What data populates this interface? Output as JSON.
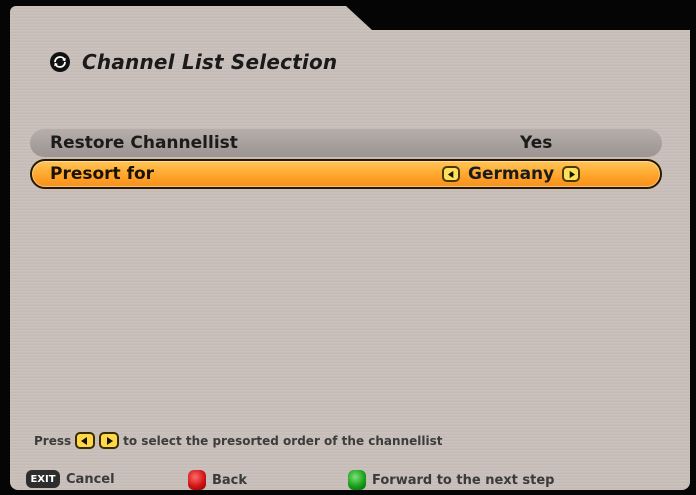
{
  "screen": {
    "title": "Channel List Selection",
    "title_icon": "circle-arrow-icon"
  },
  "rows": [
    {
      "label": "Restore Channellist",
      "value": "Yes",
      "selected": false
    },
    {
      "label": "Presort for",
      "value": "Germany",
      "selected": true
    }
  ],
  "hint": {
    "prefix": "Press",
    "suffix": "to select the presorted order of the channellist",
    "left_icon": "left-arrow-icon",
    "right_icon": "right-arrow-icon"
  },
  "footer": {
    "exit_label": "EXIT",
    "cancel_label": "Cancel",
    "back_label": "Back",
    "forward_label": "Forward to the next step"
  },
  "colors": {
    "panel": "#c8bfba",
    "selected_row": "#ffb13b",
    "red_button": "#d11515",
    "green_button": "#1aa11a"
  }
}
